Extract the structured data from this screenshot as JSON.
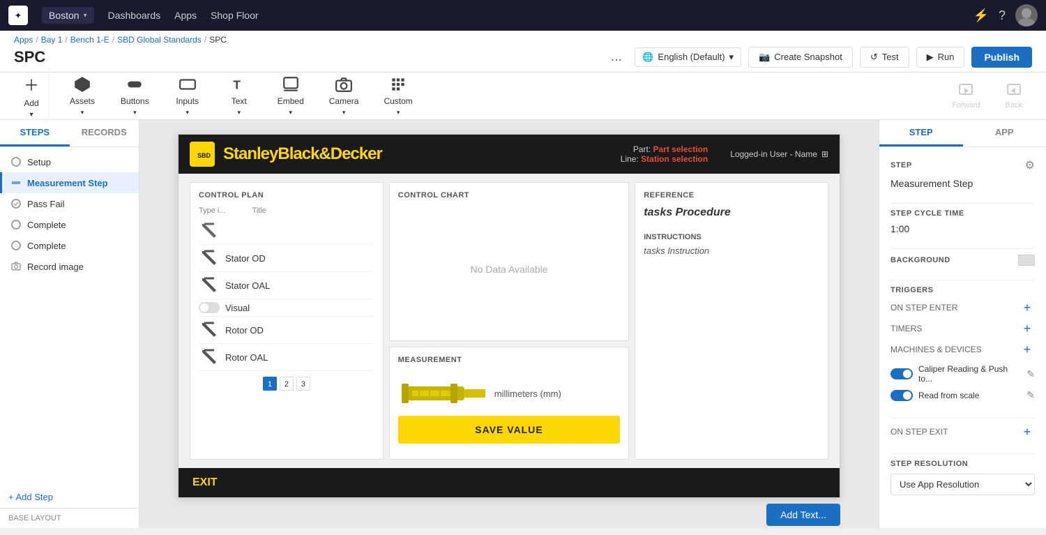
{
  "topnav": {
    "location": "Boston",
    "links": [
      "Dashboards",
      "Apps",
      "Shop Floor"
    ]
  },
  "breadcrumb": {
    "items": [
      "Apps",
      "Bay 1",
      "Bench 1-E",
      "SBD Global Standards",
      "SPC"
    ]
  },
  "page": {
    "title": "SPC"
  },
  "toolbar_actions": {
    "more_label": "...",
    "language_label": "English (Default)",
    "snapshot_label": "Create Snapshot",
    "test_label": "Test",
    "run_label": "Run",
    "publish_label": "Publish"
  },
  "toolbar": {
    "add_label": "Add",
    "assets_label": "Assets",
    "buttons_label": "Buttons",
    "inputs_label": "Inputs",
    "text_label": "Text",
    "embed_label": "Embed",
    "camera_label": "Camera",
    "custom_label": "Custom",
    "forward_label": "Forward",
    "back_label": "Back"
  },
  "sidebar": {
    "steps_tab": "STEPS",
    "records_tab": "RECORDS",
    "steps": [
      {
        "label": "Setup",
        "icon": "setup"
      },
      {
        "label": "Measurement Step",
        "icon": "measure",
        "active": true
      },
      {
        "label": "Pass Fail",
        "icon": "passfail"
      },
      {
        "label": "Complete",
        "icon": "complete"
      },
      {
        "label": "Complete",
        "icon": "complete"
      },
      {
        "label": "Record image",
        "icon": "camera"
      }
    ],
    "add_step_label": "+ Add Step",
    "base_layout_label": "BASE LAYOUT"
  },
  "app_canvas": {
    "brand": "StanleyBlack&Decker",
    "part_label": "Part:",
    "part_value": "Part selection",
    "line_label": "Line:",
    "line_value": "Station selection",
    "user_label": "Logged-in User - Name",
    "control_plan": {
      "title": "CONTROL PLAN",
      "col1_header": "Type i...",
      "col2_header": "Title",
      "rows": [
        {
          "title": ""
        },
        {
          "title": "Stator OD"
        },
        {
          "title": "Stator OAL"
        },
        {
          "title": "Visual"
        },
        {
          "title": "Rotor OD"
        },
        {
          "title": "Rotor OAL"
        }
      ],
      "pagination": [
        "1",
        "2",
        "3"
      ]
    },
    "control_chart": {
      "title": "CONTROL CHART",
      "no_data": "No Data Available"
    },
    "measurement": {
      "title": "MEASUREMENT",
      "unit_label": "millimeters (mm)",
      "save_btn": "SAVE VALUE"
    },
    "reference": {
      "title": "REFERENCE",
      "text": "tasks Procedure"
    },
    "instructions": {
      "title": "INSTRUCTIONS",
      "text": "tasks Instruction"
    },
    "footer_exit": "EXIT"
  },
  "right_panel": {
    "step_tab": "STEP",
    "app_tab": "APP",
    "step_section": {
      "title": "STEP",
      "value": "Measurement Step"
    },
    "cycle_time": {
      "title": "STEP CYCLE TIME",
      "value": "1:00"
    },
    "background": {
      "title": "BACKGROUND"
    },
    "triggers": {
      "title": "TRIGGERS",
      "on_step_enter": "ON STEP ENTER",
      "timers": "TIMERS",
      "machines_devices": "MACHINES & DEVICES",
      "device1": "Caliper Reading & Push to...",
      "device2": "Read from scale"
    },
    "on_step_exit": "ON STEP EXIT",
    "step_resolution": {
      "title": "STEP RESOLUTION",
      "value": "Use App Resolution"
    }
  },
  "bottom_bar": {
    "add_text_btn": "Add Text..."
  }
}
